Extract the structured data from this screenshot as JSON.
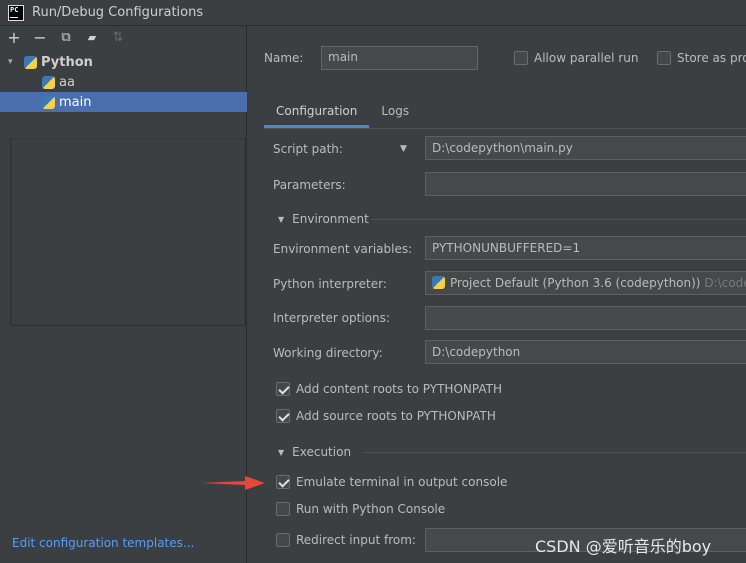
{
  "window": {
    "title": "Run/Debug Configurations",
    "app_icon_text": "PC"
  },
  "toolbar": {
    "add": "+",
    "remove": "−",
    "copy": "⧉",
    "folder": "▰",
    "sort": "⇅"
  },
  "tree": {
    "root": {
      "label": "Python",
      "expand_glyph": "▾"
    },
    "items": [
      {
        "label": "aa"
      },
      {
        "label": "main"
      }
    ]
  },
  "left_footer": {
    "edit_templates": "Edit configuration templates..."
  },
  "header": {
    "name_label": "Name:",
    "name_value": "main",
    "allow_parallel": "Allow parallel run",
    "store_as": "Store as pro"
  },
  "tabs": [
    {
      "label": "Configuration"
    },
    {
      "label": "Logs"
    }
  ],
  "form": {
    "script_path_label": "Script path:",
    "script_path_value": "D:\\codepython\\main.py",
    "parameters_label": "Parameters:",
    "parameters_value": "",
    "environment_section": "Environment",
    "env_vars_label": "Environment variables:",
    "env_vars_value": "PYTHONUNBUFFERED=1",
    "interpreter_label": "Python interpreter:",
    "interpreter_value": "Project Default (Python 3.6 (codepython))",
    "interpreter_path": "D:\\codep",
    "interp_options_label": "Interpreter options:",
    "interp_options_value": "",
    "working_dir_label": "Working directory:",
    "working_dir_value": "D:\\codepython",
    "add_content_roots": "Add content roots to PYTHONPATH",
    "add_source_roots": "Add source roots to PYTHONPATH",
    "execution_section": "Execution",
    "emulate_terminal": "Emulate terminal in output console",
    "run_with_console": "Run with Python Console",
    "redirect_input": "Redirect input from:",
    "redirect_input_value": ""
  },
  "watermark": "CSDN @爱听音乐的boy",
  "colors": {
    "accent": "#4a88c7",
    "selection": "#4b6eaf",
    "link": "#589df6",
    "arrow": "#e8453c"
  }
}
